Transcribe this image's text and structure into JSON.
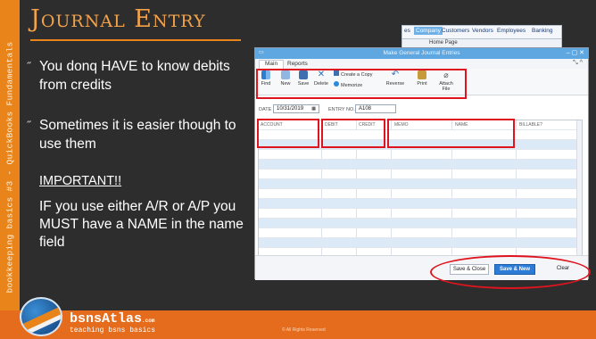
{
  "slide": {
    "title": "Journal Entry",
    "side_label": "bookkeeping basics #3 - QuickBooks Fundamentals",
    "bullets": [
      {
        "mark": "˝",
        "text": "You donq HAVE to know debits from credits"
      },
      {
        "mark": "˝",
        "text": "Sometimes it is easier though to use them"
      }
    ],
    "important_heading": "IMPORTANT!!",
    "important_text": "IF you use either A/R or A/P you MUST have a NAME in the name field",
    "brand": "bsnsAtlas",
    "brand_sup": ".com",
    "tagline": "teaching bsns basics",
    "rights": "© All Rights Reserved",
    "accent_color": "#e8841a",
    "title_color": "#f2a24a"
  },
  "qb_menubar": {
    "items": [
      "es",
      "Company",
      "Customers",
      "Vendors",
      "Employees",
      "Banking"
    ],
    "home_tab": "Home Page"
  },
  "journal_window": {
    "title": "Make General Journal Entries",
    "tabs": [
      "Main",
      "Reports"
    ],
    "toolbar": {
      "find": "Find",
      "new": "New",
      "save": "Save",
      "delete": "Delete",
      "create_copy": "Create a Copy",
      "memorize": "Memorize",
      "reverse": "Reverse",
      "print": "Print",
      "attach": "Attach File"
    },
    "date_label": "DATE",
    "date_value": "10/31/2019",
    "entry_label": "ENTRY NO.",
    "entry_value": "A108",
    "columns": [
      "ACCOUNT",
      "DEBIT",
      "CREDIT",
      "MEMO",
      "NAME",
      "BILLABLE?"
    ],
    "buttons": {
      "save_close": "Save & Close",
      "save_new": "Save & New",
      "clear": "Clear"
    },
    "highlight_color": "#e0141e"
  }
}
